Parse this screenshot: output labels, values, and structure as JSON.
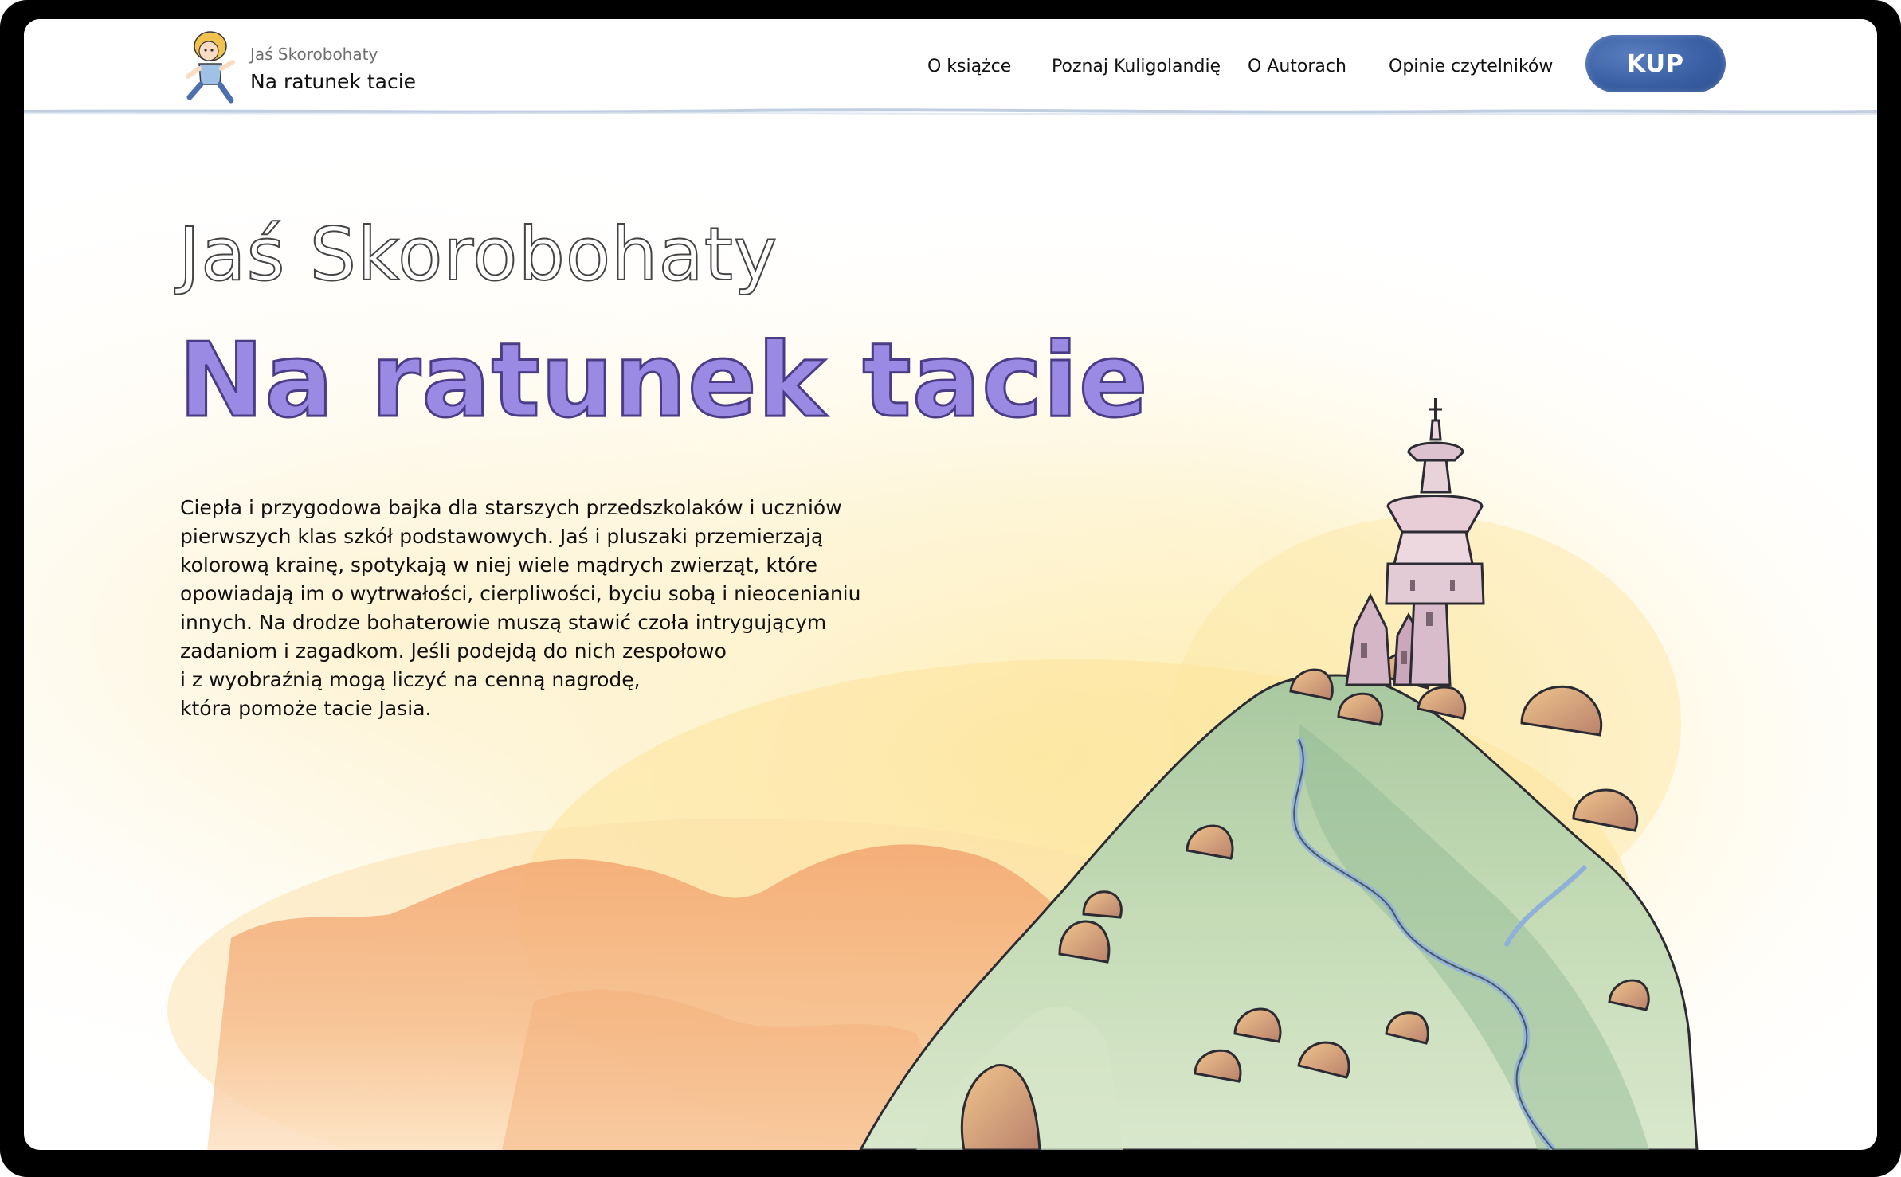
{
  "header": {
    "logo": {
      "subtitle": "Jaś Skorobohaty",
      "title": "Na ratunek tacie",
      "icon": "mascot-icon"
    },
    "nav": [
      {
        "label": "O książce"
      },
      {
        "label": "Poznaj Kuligolandię"
      },
      {
        "label": "O Autorach"
      },
      {
        "label": "Opinie czytelników"
      }
    ],
    "buy_label": "KUP"
  },
  "hero": {
    "subtitle": "Jaś Skorobohaty",
    "title": "Na ratunek tacie",
    "description_lines": [
      "Ciepła i przygodowa bajka dla starszych przedszkolaków i uczniów",
      "pierwszych klas szkół podstawowych. Jaś i pluszaki przemierzają",
      "kolorową krainę, spotykają w niej wiele mądrych zwierząt, które",
      "opowiadają im o wytrwałości, cierpliwości, byciu sobą i nieocenianiu",
      "innych. Na drodze bohaterowie muszą stawić czoła intrygującym",
      "zadaniom i zagadkom. Jeśli podejdą do nich zespołowo",
      "i z wyobraźnią mogą liczyć na cenną nagrodę,",
      "która pomoże tacie Jasia."
    ]
  },
  "colors": {
    "accent": "#9b8ae3",
    "button": "#3a60a5",
    "header_line": "#b9c9dd",
    "text": "#111111"
  }
}
